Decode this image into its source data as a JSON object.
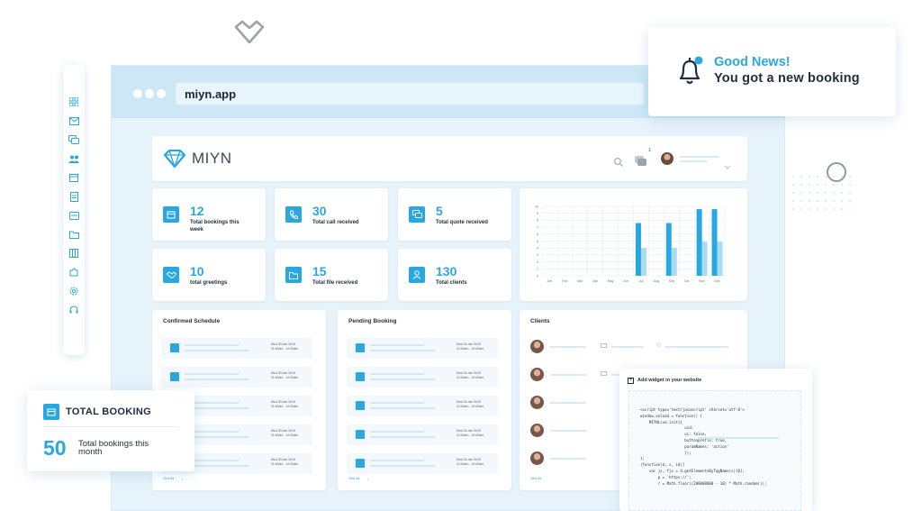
{
  "browser": {
    "url": "miyn.app"
  },
  "app": {
    "brand": "MIYN",
    "notification_count": "1"
  },
  "stats": [
    {
      "value": "12",
      "label": "Total bookings this week",
      "icon": "calendar-icon"
    },
    {
      "value": "30",
      "label": "Total call received",
      "icon": "phone-icon"
    },
    {
      "value": "5",
      "label": "Total quote received",
      "icon": "quote-icon"
    },
    {
      "value": "10",
      "label": "total greetings",
      "icon": "handshake-icon"
    },
    {
      "value": "15",
      "label": "Total file received",
      "icon": "file-icon"
    },
    {
      "value": "130",
      "label": "Total clients",
      "icon": "user-icon"
    }
  ],
  "chart_data": {
    "type": "bar",
    "categories": [
      "Jan",
      "Feb",
      "Mar",
      "Apr",
      "May",
      "Jun",
      "Jul",
      "Aug",
      "Sep",
      "Oct",
      "Nov",
      "Dec"
    ],
    "series": [
      {
        "values": [
          0,
          0,
          0,
          0,
          0,
          0,
          7.6,
          0,
          7.6,
          0,
          9.6,
          9.6
        ]
      },
      {
        "values": [
          0,
          0,
          0,
          0,
          0,
          0,
          4.0,
          0,
          4.0,
          0,
          4.9,
          4.9
        ]
      }
    ],
    "ylim": [
      0,
      10
    ],
    "yticks": [
      "0",
      "1",
      "2",
      "3",
      "4",
      "5",
      "6",
      "7",
      "8",
      "9",
      "10"
    ],
    "grid": true,
    "colors": [
      "#29a7e1",
      "#a9dbf3"
    ]
  },
  "panels": {
    "confirmed": {
      "title": "Confirmed Schedule",
      "view_all": "View All"
    },
    "pending": {
      "title": "Pending Booking",
      "view_all": "View All"
    },
    "clients": {
      "title": "Clients",
      "view_all": "View All"
    }
  },
  "schedule_row_time": [
    "Mon 00 Jan 2019",
    "11:00am - 12:00am"
  ],
  "widget": {
    "title": "Add widget in your website",
    "code": "<script type='text/javascript' charset='utf-8'>\nwindow.onload = function() {\n    MIYNLive.init({\n                    uid: \n                    ui: false,\n                    buttonprefix: true,\n                    paramNames: 'action'\n                    });\n};\n(function(d, s, id){\n    var js, fjs = d.getElementsByTagName(s)[0];\n        p = 'https://';\n        r = Math.floor((200000000 - 10) * Math.random());"
  },
  "notification": {
    "title": "Good News!",
    "message": "You got a new booking"
  },
  "total_booking": {
    "title": "TOTAL BOOKING",
    "value": "50",
    "label": "Total bookings this month"
  }
}
